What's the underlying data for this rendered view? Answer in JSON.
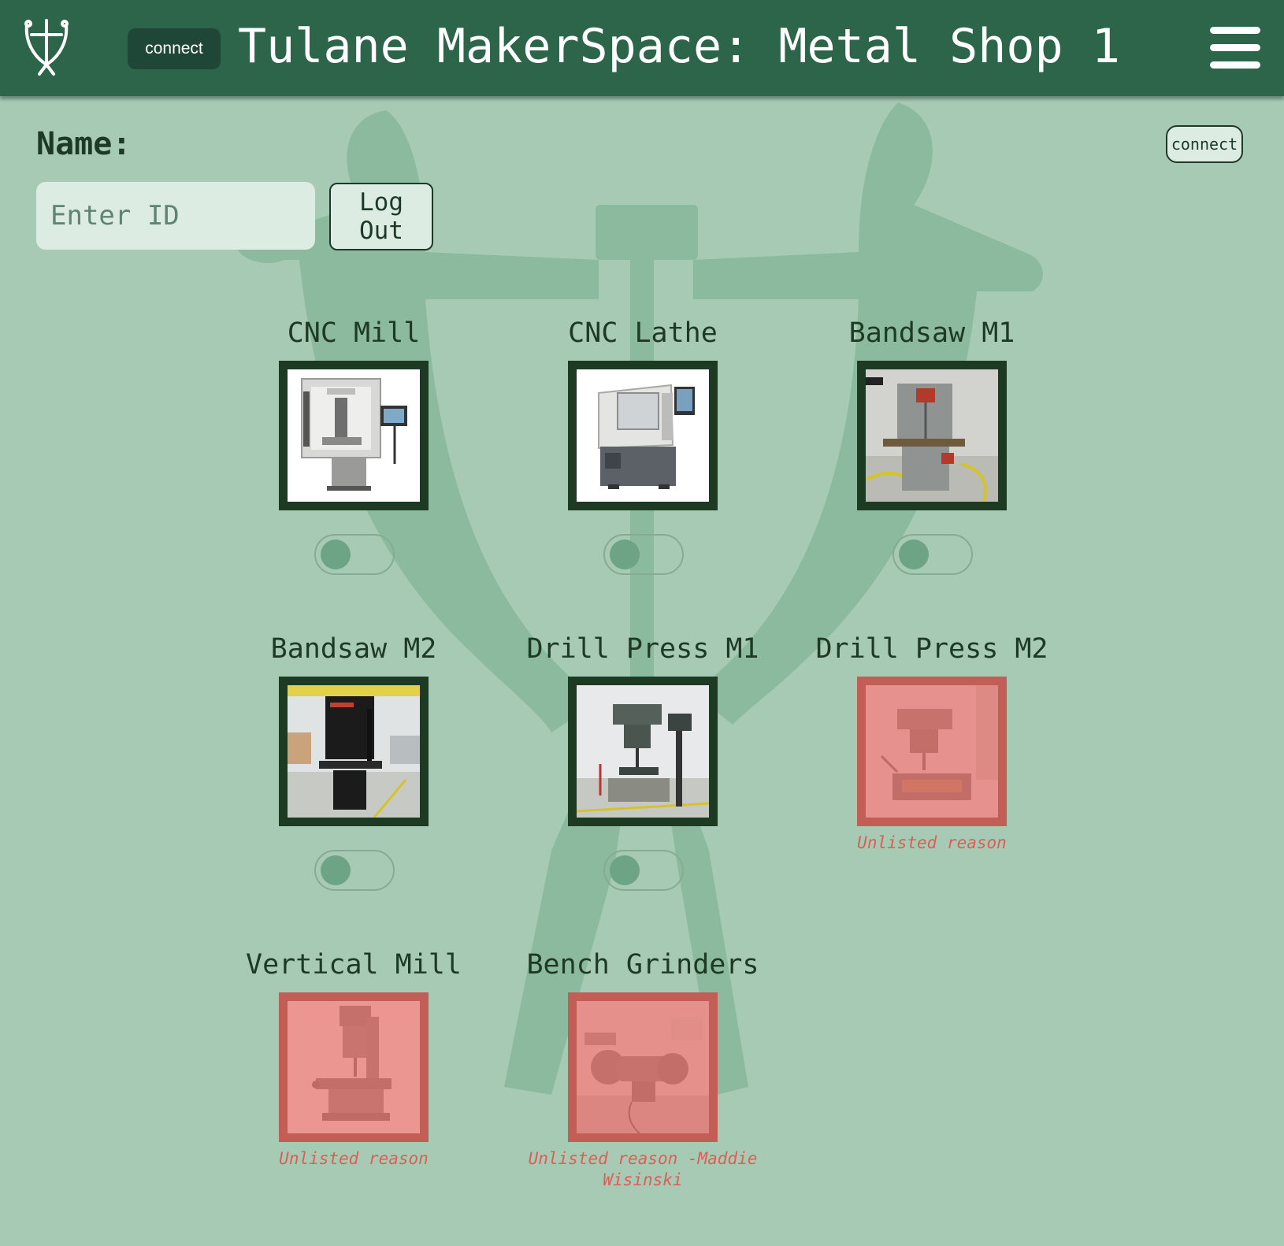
{
  "header": {
    "connect_label": "connect",
    "title": "Tulane MakerSpace: Metal Shop 1"
  },
  "login": {
    "name_label": "Name:",
    "id_placeholder": "Enter ID",
    "logout_label": "Log Out",
    "connect_label": "connect"
  },
  "colors": {
    "header_bg": "#2c654a",
    "page_bg": "#a6cab4",
    "frame_available": "#1d3a22",
    "frame_down": "#c35e57",
    "reason_text": "#e05c55"
  },
  "machines": [
    {
      "name": "CNC Mill",
      "status": "available",
      "image": "cnc-mill-icon",
      "toggle_on": false
    },
    {
      "name": "CNC Lathe",
      "status": "available",
      "image": "cnc-lathe-icon",
      "toggle_on": false
    },
    {
      "name": "Bandsaw M1",
      "status": "available",
      "image": "bandsaw-icon",
      "toggle_on": false
    },
    {
      "name": "Bandsaw M2",
      "status": "available",
      "image": "bandsaw-icon",
      "toggle_on": false
    },
    {
      "name": "Drill Press M1",
      "status": "available",
      "image": "drill-press-icon",
      "toggle_on": false
    },
    {
      "name": "Drill Press M2",
      "status": "down",
      "image": "drill-press-icon",
      "reason": "Unlisted reason"
    },
    {
      "name": "Vertical Mill",
      "status": "down",
      "image": "vertical-mill-icon",
      "reason": "Unlisted reason"
    },
    {
      "name": "Bench Grinders",
      "status": "down",
      "image": "bench-grinder-icon",
      "reason": "Unlisted reason -Maddie Wisinski"
    }
  ]
}
